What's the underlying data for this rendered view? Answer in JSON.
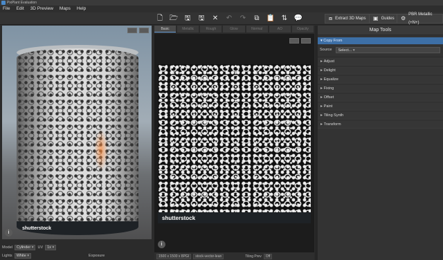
{
  "window": {
    "title": "PixPlant Evaluation"
  },
  "menu": [
    {
      "label": "File"
    },
    {
      "label": "Edit"
    },
    {
      "label": "3D Preview"
    },
    {
      "label": "Maps"
    },
    {
      "label": "Help"
    }
  ],
  "toolbar": {
    "extract_label": "Extract 3D Maps",
    "guides_label": "Guides",
    "pbr_label": "PBR Metallic (+N+)"
  },
  "viewer_tabs": [
    {
      "label": "Basic"
    },
    {
      "label": "Metallic"
    },
    {
      "label": "Rough"
    },
    {
      "label": "Glow"
    },
    {
      "label": "Normal"
    },
    {
      "label": "AO"
    },
    {
      "label": "Opacity"
    }
  ],
  "watermark": {
    "text": "shutterstock"
  },
  "left_controls": {
    "model_label": "Model",
    "model_value": "Cylinder",
    "uv_label": "UV",
    "uv_value": "1x",
    "lights_label": "Lights",
    "lights_value": "White",
    "exposure_label": "Exposure"
  },
  "status_bar": {
    "dimensions": "1500 x 1500 x 8PGI",
    "filename": "stock-vector-lean",
    "tiling_preview_label": "Tiling Prev",
    "tiling_preview_value": "Off"
  },
  "map_tools": {
    "title": "Map Tools",
    "section": "Copy From",
    "source_label": "Source",
    "source_value": "Select...",
    "items": [
      {
        "label": "Adjust"
      },
      {
        "label": "Delight"
      },
      {
        "label": "Equalize"
      },
      {
        "label": "Fixing"
      },
      {
        "label": "Offset"
      },
      {
        "label": "Paint"
      },
      {
        "label": "Tiling Synth"
      },
      {
        "label": "Transform"
      }
    ]
  }
}
